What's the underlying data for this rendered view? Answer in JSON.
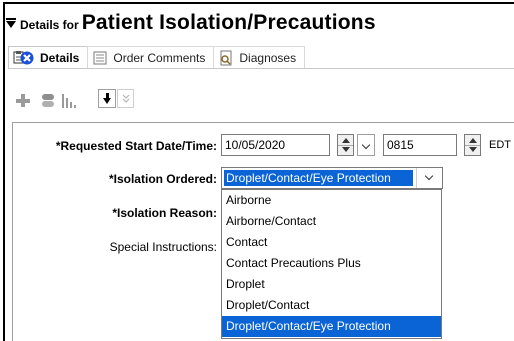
{
  "header": {
    "prefix": "Details for",
    "title": "Patient Isolation/Precautions"
  },
  "tabs": [
    {
      "label": "Details",
      "icon": "details-error-icon",
      "active": true
    },
    {
      "label": "Order Comments",
      "icon": "comments-icon",
      "active": false
    },
    {
      "label": "Diagnoses",
      "icon": "diagnoses-icon",
      "active": false
    }
  ],
  "toolbar": {
    "icons": [
      "add-icon",
      "medication-icon",
      "chart-bars-icon",
      "move-down-icon",
      "collapse-icon"
    ]
  },
  "form": {
    "start": {
      "label": "*Requested Start Date/Time:",
      "date": "10/05/2020",
      "time": "0815",
      "timezone": "EDT"
    },
    "isolation_ordered": {
      "label": "*Isolation Ordered:",
      "value": "Droplet/Contact/Eye Protection"
    },
    "isolation_reason": {
      "label": "*Isolation Reason:"
    },
    "special_instructions": {
      "label": "Special Instructions:"
    }
  },
  "dropdown": {
    "options": [
      "Airborne",
      "Airborne/Contact",
      "Contact",
      "Contact Precautions Plus",
      "Droplet",
      "Droplet/Contact",
      "Droplet/Contact/Eye Protection"
    ],
    "selected_index": 6
  },
  "colors": {
    "selection": "#0a64d6",
    "error": "#1a4fd6"
  }
}
